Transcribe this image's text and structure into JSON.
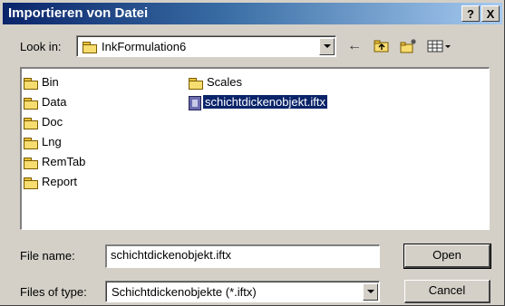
{
  "window": {
    "title": "Importieren von Datei",
    "help_label": "?",
    "close_label": "X"
  },
  "look_in": {
    "label": "Look in:",
    "value": "InkFormulation6"
  },
  "toolbar": {
    "back_icon": "back-arrow-icon",
    "up_icon": "up-folder-icon",
    "new_folder_icon": "new-folder-icon",
    "view_icon": "view-menu-icon"
  },
  "files": {
    "column1": [
      {
        "name": "Bin",
        "type": "folder"
      },
      {
        "name": "Data",
        "type": "folder"
      },
      {
        "name": "Doc",
        "type": "folder"
      },
      {
        "name": "Lng",
        "type": "folder"
      },
      {
        "name": "RemTab",
        "type": "folder"
      },
      {
        "name": "Report",
        "type": "folder"
      }
    ],
    "column2": [
      {
        "name": "Scales",
        "type": "folder"
      },
      {
        "name": "schichtdickenobjekt.iftx",
        "type": "file",
        "selected": true
      }
    ]
  },
  "file_name": {
    "label": "File name:",
    "value": "schichtdickenobjekt.iftx"
  },
  "file_type": {
    "label": "Files of type:",
    "value": "Schichtdickenobjekte (*.iftx)"
  },
  "buttons": {
    "open": "Open",
    "cancel": "Cancel"
  },
  "colors": {
    "selection": "#0a246a",
    "dialog_bg": "#d4d0c8"
  }
}
